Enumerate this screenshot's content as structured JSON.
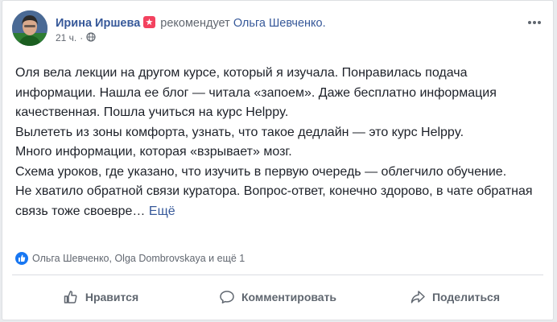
{
  "post": {
    "author": "Ирина Иршева",
    "verb": "рекомендует",
    "target": "Ольга Шевченко.",
    "time": "21 ч.",
    "dot": "·",
    "paragraphs": [
      "Оля вела лекции на другом курсе, который я изучала. Понравилась подача информации. Нашла ее блог — читала «запоем». Даже бесплатно информация качественная. Пошла учиться на курс Helppy.",
      "Вылететь из зоны комфорта, узнать, что такое дедлайн — это курс Helppy.",
      "Много информации, которая «взрывает» мозг.",
      "Схема уроков, где указано, что изучить в первую очередь — облегчило обучение."
    ],
    "last_paragraph": "Не хватило обратной связи куратора. Вопрос-ответ, конечно здорово, в чате обратная связь тоже своевре…",
    "see_more": "Ещё"
  },
  "reactions": {
    "text": "Ольга Шевченко, Olga Dombrovskaya и ещё 1"
  },
  "actions": {
    "like": "Нравится",
    "comment": "Комментировать",
    "share": "Поделиться"
  },
  "colors": {
    "link": "#365899",
    "recommend": "#f3425f",
    "like": "#1877f2"
  }
}
